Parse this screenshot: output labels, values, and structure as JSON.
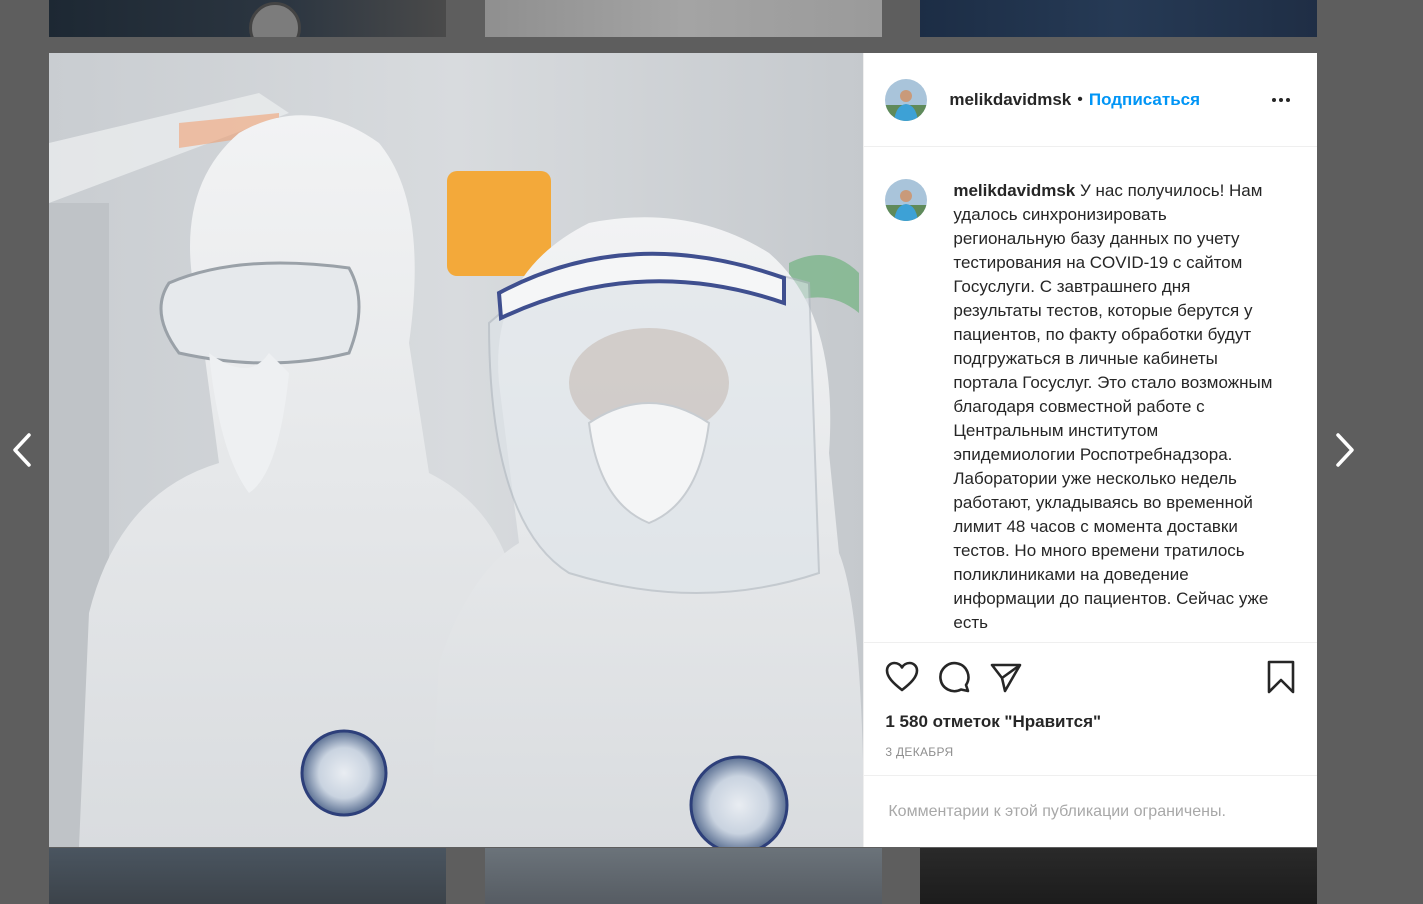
{
  "post": {
    "username": "melikdavidmsk",
    "separator": "•",
    "follow_label": "Подписаться",
    "caption_text": "У нас получилось! Нам удалось синхронизировать региональную базу данных по учету тестирования на COVID-19 с сайтом Госуслуги. С завтрашнего дня результаты тестов, которые берутся у пациентов, по факту обработки будут подгружаться в личные кабинеты портала Госуслуг. Это стало возможным благодаря совместной работе с Центральным институтом эпидемиологии Роспотребнадзора. Лаборатории уже несколько недель работают, укладываясь во временной лимит 48 часов с момента доставки тестов. Но много времени тратилось поликлиниками на доведение информации до пациентов. Сейчас уже есть",
    "likes_text": "1 580 отметок \"Нравится\"",
    "date_text": "3 ДЕКАБРЯ",
    "comments_notice": "Комментарии к этой публикации ограничены."
  },
  "icons": {
    "nav_prev": "chevron-left-icon",
    "nav_next": "chevron-right-icon",
    "more": "more-horizontal-icon",
    "like": "heart-icon",
    "comment": "comment-icon",
    "share": "send-icon",
    "save": "bookmark-icon"
  },
  "colors": {
    "accent": "#0095f6",
    "text": "#262626",
    "muted": "#8e8e8e",
    "overlay": "#5e5e5e"
  }
}
